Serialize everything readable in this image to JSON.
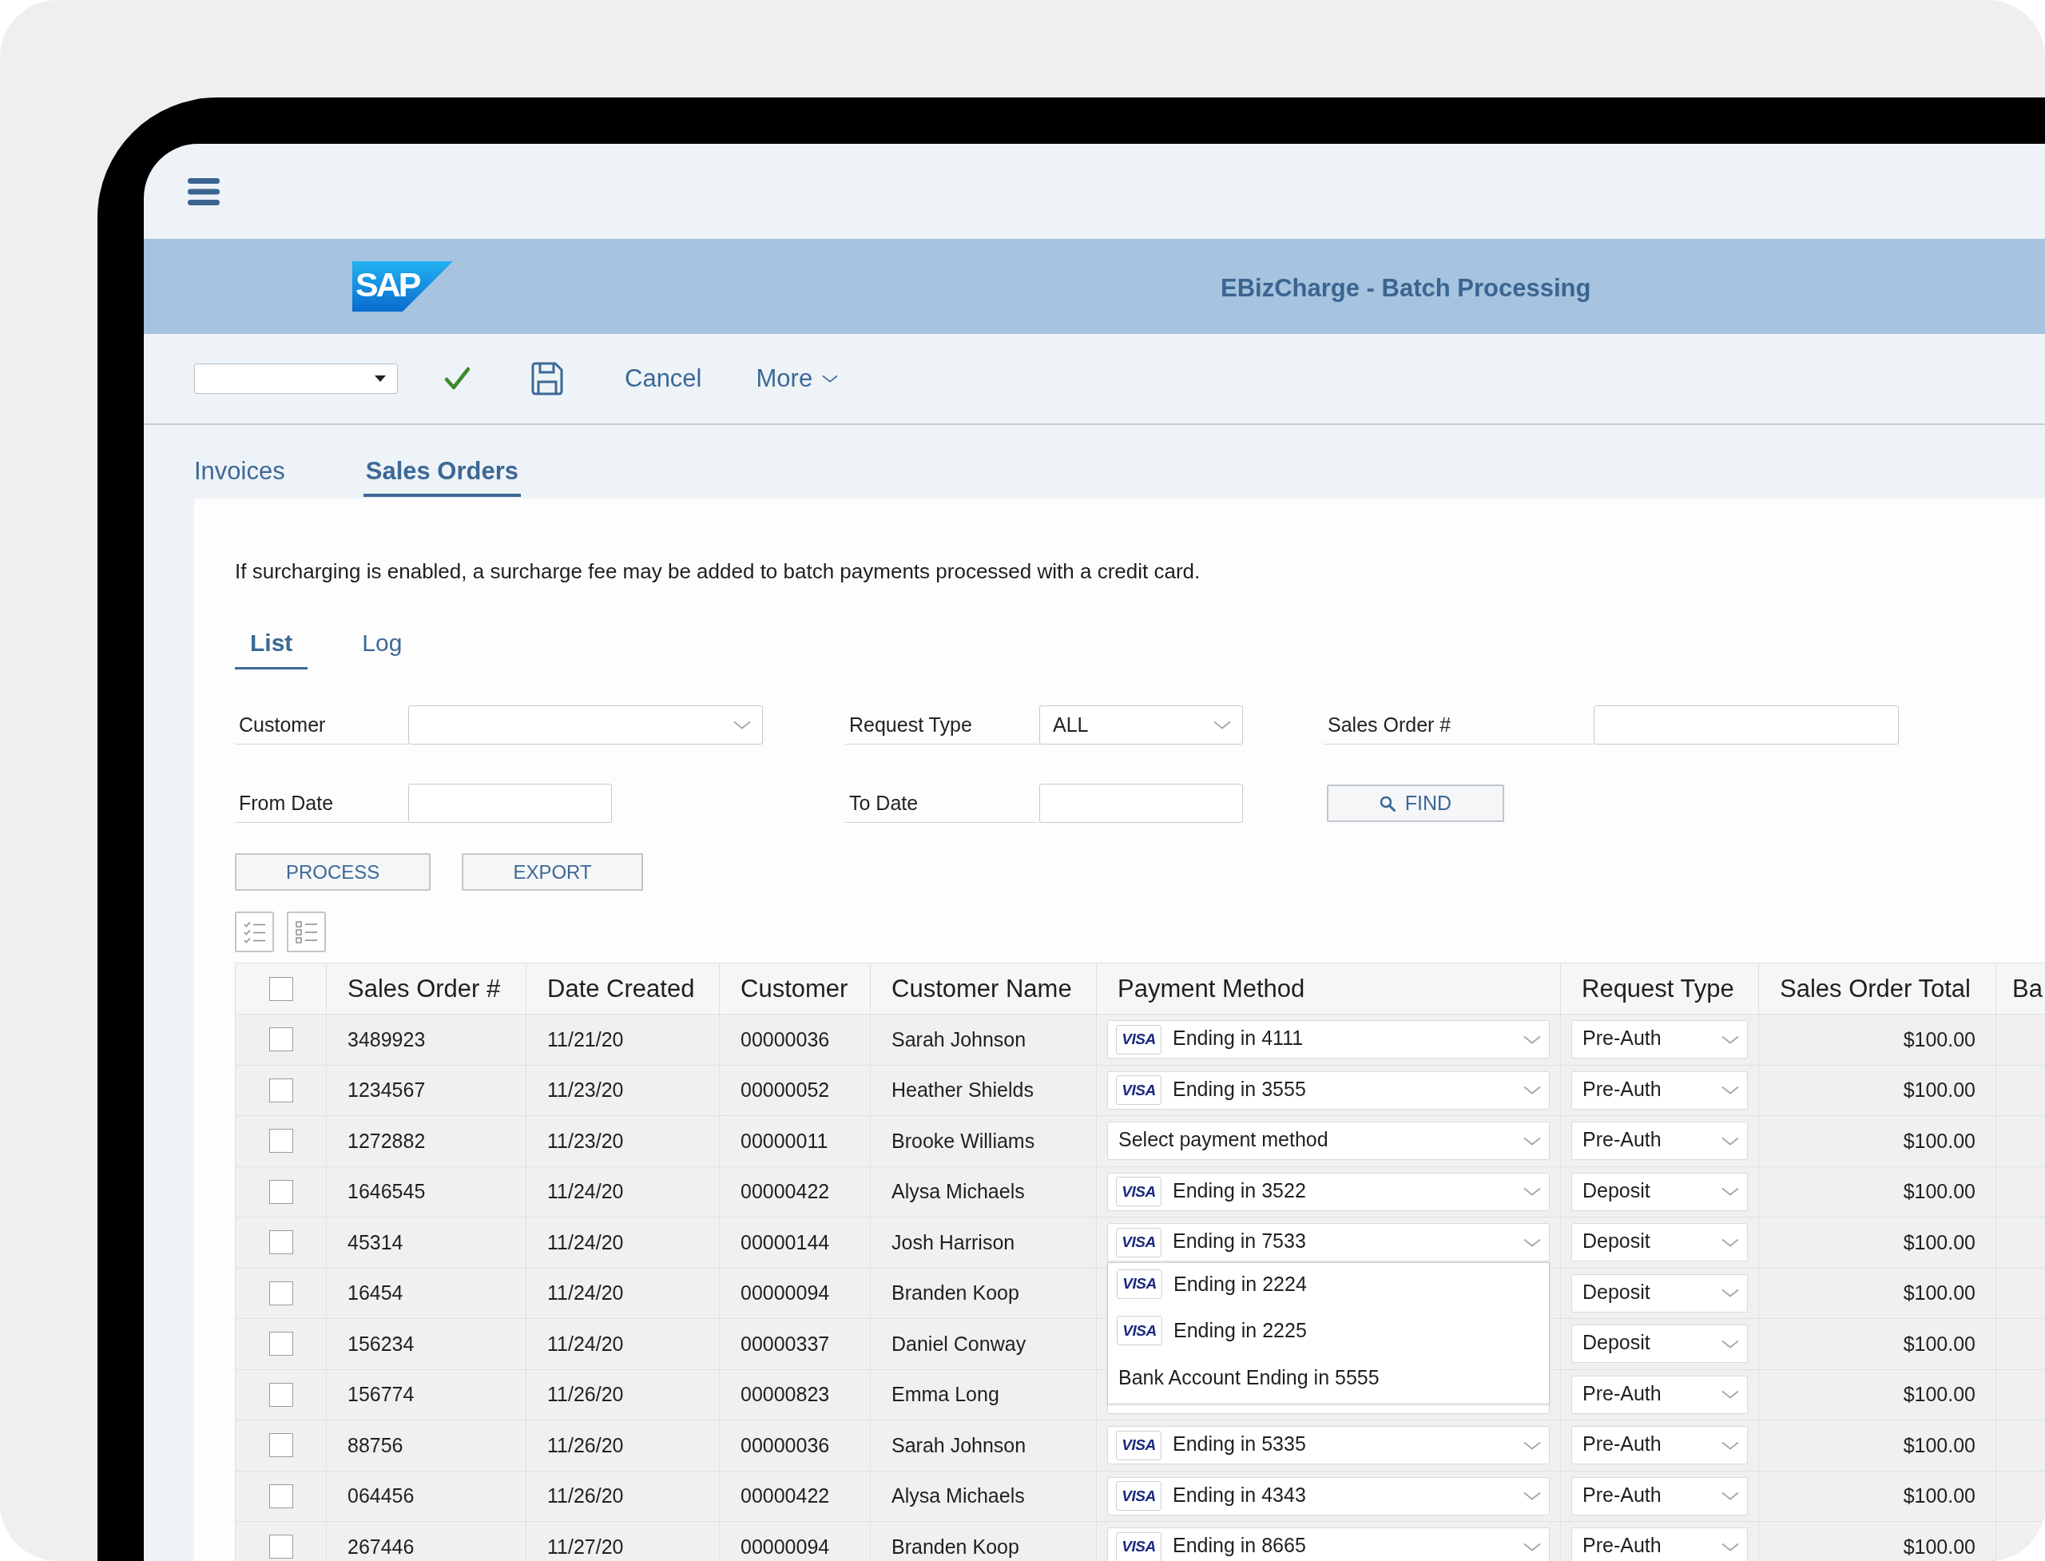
{
  "header": {
    "logo": "SAP",
    "title": "EBizCharge - Batch Processing"
  },
  "toolbar": {
    "cancel": "Cancel",
    "more": "More"
  },
  "tabs": [
    {
      "label": "Invoices",
      "selected": false
    },
    {
      "label": "Sales Orders",
      "selected": true
    }
  ],
  "notice": "If surcharging is enabled, a surcharge fee may be added to batch payments processed with a credit card.",
  "subtabs": [
    {
      "label": "List",
      "selected": true
    },
    {
      "label": "Log",
      "selected": false
    }
  ],
  "filters": [
    {
      "label": "Customer",
      "kind": "combo"
    },
    {
      "label": "Request Type",
      "kind": "combo",
      "value": "ALL"
    },
    {
      "label": "Sales Order #",
      "kind": "text"
    },
    {
      "label": "From Date",
      "kind": "text"
    },
    {
      "label": "To Date",
      "kind": "text"
    }
  ],
  "find_button": "FIND",
  "actions": [
    "PROCESS",
    "EXPORT"
  ],
  "table": {
    "all_checked": false,
    "columns": [
      "Sales Order #",
      "Date Created",
      "Customer",
      "Customer Name",
      "Payment Method",
      "Request Type",
      "Sales Order Total",
      "Ba"
    ],
    "rows": [
      {
        "checked": false,
        "order": "3489923",
        "date": "11/21/20",
        "customer": "00000036",
        "name": "Sarah Johnson",
        "payment": {
          "kind": "card",
          "brand": "VISA",
          "text": "Ending in 4111"
        },
        "request_type": "Pre-Auth",
        "total": "$100.00"
      },
      {
        "checked": false,
        "order": "1234567",
        "date": "11/23/20",
        "customer": "00000052",
        "name": "Heather Shields",
        "payment": {
          "kind": "card",
          "brand": "VISA",
          "text": "Ending in 3555"
        },
        "request_type": "Pre-Auth",
        "total": "$100.00"
      },
      {
        "checked": false,
        "order": "1272882",
        "date": "11/23/20",
        "customer": "00000011",
        "name": "Brooke Williams",
        "payment": {
          "kind": "prompt",
          "text": "Select payment method"
        },
        "request_type": "Pre-Auth",
        "total": "$100.00"
      },
      {
        "checked": false,
        "order": "1646545",
        "date": "11/24/20",
        "customer": "00000422",
        "name": "Alysa Michaels",
        "payment": {
          "kind": "card",
          "brand": "VISA",
          "text": "Ending in 3522"
        },
        "request_type": "Deposit",
        "total": "$100.00"
      },
      {
        "checked": false,
        "order": "45314",
        "date": "11/24/20",
        "customer": "00000144",
        "name": "Josh Harrison",
        "payment": {
          "kind": "card",
          "brand": "VISA",
          "text": "Ending in 7533",
          "options": [
            {
              "kind": "card",
              "brand": "VISA",
              "text": "Ending in 2224"
            },
            {
              "kind": "card",
              "brand": "VISA",
              "text": "Ending in 2225"
            },
            {
              "kind": "bank",
              "text": "Bank Account Ending in 5555"
            }
          ]
        },
        "request_type": "Deposit",
        "total": "$100.00"
      },
      {
        "checked": false,
        "order": "16454",
        "date": "11/24/20",
        "customer": "00000094",
        "name": "Branden Koop",
        "request_type": "Deposit",
        "total": "$100.00"
      },
      {
        "checked": false,
        "order": "156234",
        "date": "11/24/20",
        "customer": "00000337",
        "name": "Daniel Conway",
        "request_type": "Deposit",
        "total": "$100.00"
      },
      {
        "checked": false,
        "order": "156774",
        "date": "11/26/20",
        "customer": "00000823",
        "name": "Emma Long",
        "payment": {
          "kind": "covered"
        },
        "request_type": "Pre-Auth",
        "total": "$100.00"
      },
      {
        "checked": false,
        "order": "88756",
        "date": "11/26/20",
        "customer": "00000036",
        "name": "Sarah Johnson",
        "payment": {
          "kind": "card",
          "brand": "VISA",
          "text": "Ending in 5335"
        },
        "request_type": "Pre-Auth",
        "total": "$100.00"
      },
      {
        "checked": false,
        "order": "064456",
        "date": "11/26/20",
        "customer": "00000422",
        "name": "Alysa Michaels",
        "payment": {
          "kind": "card",
          "brand": "VISA",
          "text": "Ending in 4343"
        },
        "request_type": "Pre-Auth",
        "total": "$100.00"
      },
      {
        "checked": false,
        "order": "267446",
        "date": "11/27/20",
        "customer": "00000094",
        "name": "Branden Koop",
        "payment": {
          "kind": "card",
          "brand": "VISA",
          "text": "Ending in 8665"
        },
        "request_type": "Pre-Auth",
        "total": "$100.00"
      }
    ]
  }
}
